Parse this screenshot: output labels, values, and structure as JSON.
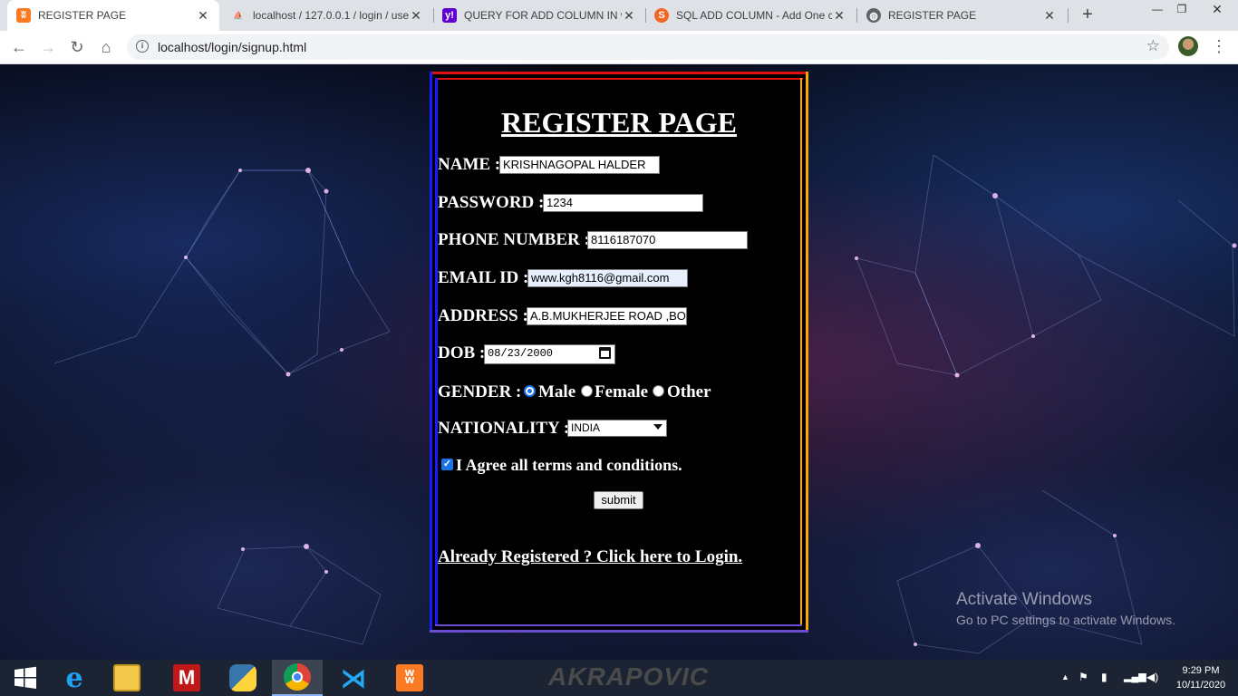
{
  "browser": {
    "tabs": [
      {
        "title": "REGISTER PAGE",
        "icon": "xampp-icon",
        "active": true
      },
      {
        "title": "localhost / 127.0.0.1 / login / use",
        "icon": "phpmyadmin-icon",
        "active": false
      },
      {
        "title": "QUERY FOR ADD COLUMN IN w",
        "icon": "yahoo-icon",
        "active": false
      },
      {
        "title": "SQL ADD COLUMN - Add One c",
        "icon": "sqltutorial-icon",
        "active": false
      },
      {
        "title": "REGISTER PAGE",
        "icon": "globe-icon",
        "active": false
      }
    ],
    "address": "localhost/login/signup.html"
  },
  "page": {
    "title": "REGISTER PAGE",
    "name_label": "NAME :",
    "name_value": "KRISHNAGOPAL HALDER",
    "password_label": "PASSWORD :",
    "password_value": "1234",
    "phone_label": "PHONE NUMBER :",
    "phone_value": "8116187070",
    "email_label": "EMAIL ID :",
    "email_value": "www.kgh8116@gmail.com",
    "address_label": "ADDRESS :",
    "address_value": "A.B.MUKHERJEE ROAD ,BO",
    "dob_label": "DOB :",
    "dob_value": "08/23/2000",
    "gender_label": "GENDER :",
    "gender_options": [
      "Male",
      "Female",
      "Other"
    ],
    "gender_selected": "Male",
    "nationality_label": "NATIONALITY :",
    "nationality_value": "INDIA",
    "agree_label": "I Agree all terms and conditions.",
    "agree_checked": true,
    "submit_label": "submit",
    "login_link": "Already Registered ? Click here to Login."
  },
  "watermark": {
    "line1": "Activate Windows",
    "line2": "Go to PC settings to activate Windows."
  },
  "taskbar": {
    "apps": [
      "windows-start-icon",
      "internet-explorer-icon",
      "file-explorer-icon",
      "mcafee-icon",
      "python-icon",
      "chrome-icon",
      "vscode-icon",
      "xampp-icon"
    ],
    "wallpaper_text": "AKRAPOVIC",
    "time": "9:29 PM",
    "date": "10/11/2020"
  },
  "colors": {
    "border_red": "#e01010",
    "border_blue": "#1a1aff",
    "border_orange": "#ffa500",
    "border_purple": "#6a4ccf",
    "accent": "#1a73e8"
  }
}
